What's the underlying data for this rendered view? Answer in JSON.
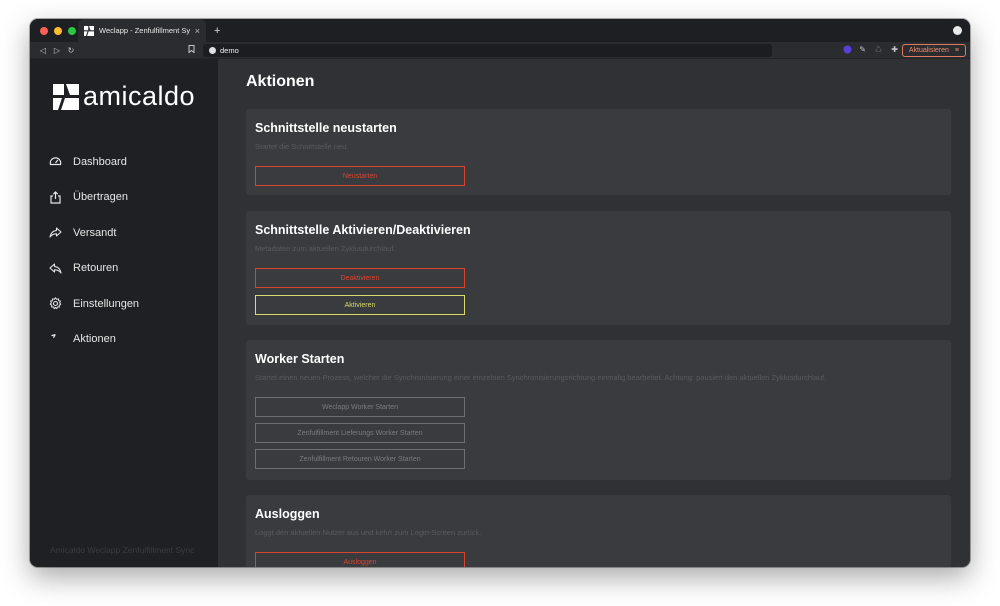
{
  "browser": {
    "tab_title": "Weclapp - Zenfulfillment Sync",
    "tab_close": "×",
    "new_tab": "+",
    "url": "demo",
    "update_label": "Aktualisieren"
  },
  "sidebar": {
    "logo_text": "amicaldo",
    "items": [
      {
        "label": "Dashboard",
        "icon": "dashboard-icon"
      },
      {
        "label": "Übertragen",
        "icon": "upload-icon"
      },
      {
        "label": "Versandt",
        "icon": "share-icon"
      },
      {
        "label": "Retouren",
        "icon": "reply-icon"
      },
      {
        "label": "Einstellungen",
        "icon": "gear-icon"
      },
      {
        "label": "Aktionen",
        "icon": "lightning-icon"
      }
    ],
    "footer": "Amicaldo Weclapp Zenfulfillment Sync"
  },
  "main": {
    "title": "Aktionen",
    "cards": [
      {
        "title": "Schnittstelle neustarten",
        "description": "Startet die Schnittstelle neu.",
        "buttons": [
          {
            "label": "Neustarten"
          }
        ]
      },
      {
        "title": "Schnittstelle Aktivieren/Deaktivieren",
        "description": "Metadaten zum aktuellen Zyklusdurchlauf.",
        "buttons": [
          {
            "label": "Deaktivieren"
          },
          {
            "label": "Aktivieren"
          }
        ]
      },
      {
        "title": "Worker Starten",
        "description": "Startet einen neuen Prozess, welcher die Synchronisierung einer einzelnen Synchronisierungsrichtung einmalig bearbeitet. Achtung: pausiert den aktuellen Zyklusdurchlauf.",
        "buttons": [
          {
            "label": "Weclapp Worker Starten"
          },
          {
            "label": "Zenfulfillment Lieferungs Worker Starten"
          },
          {
            "label": "Zenfulfillment Retouren Worker Starten"
          }
        ]
      },
      {
        "title": "Ausloggen",
        "description": "Loggt den aktuellen Nutzer aus und kehrt zum Login-Screen zurück.",
        "buttons": [
          {
            "label": "Ausloggen"
          }
        ]
      }
    ]
  },
  "colors": {
    "danger": "#d9432f",
    "success": "#d8dc6a",
    "disabled": "#6e6f74"
  }
}
